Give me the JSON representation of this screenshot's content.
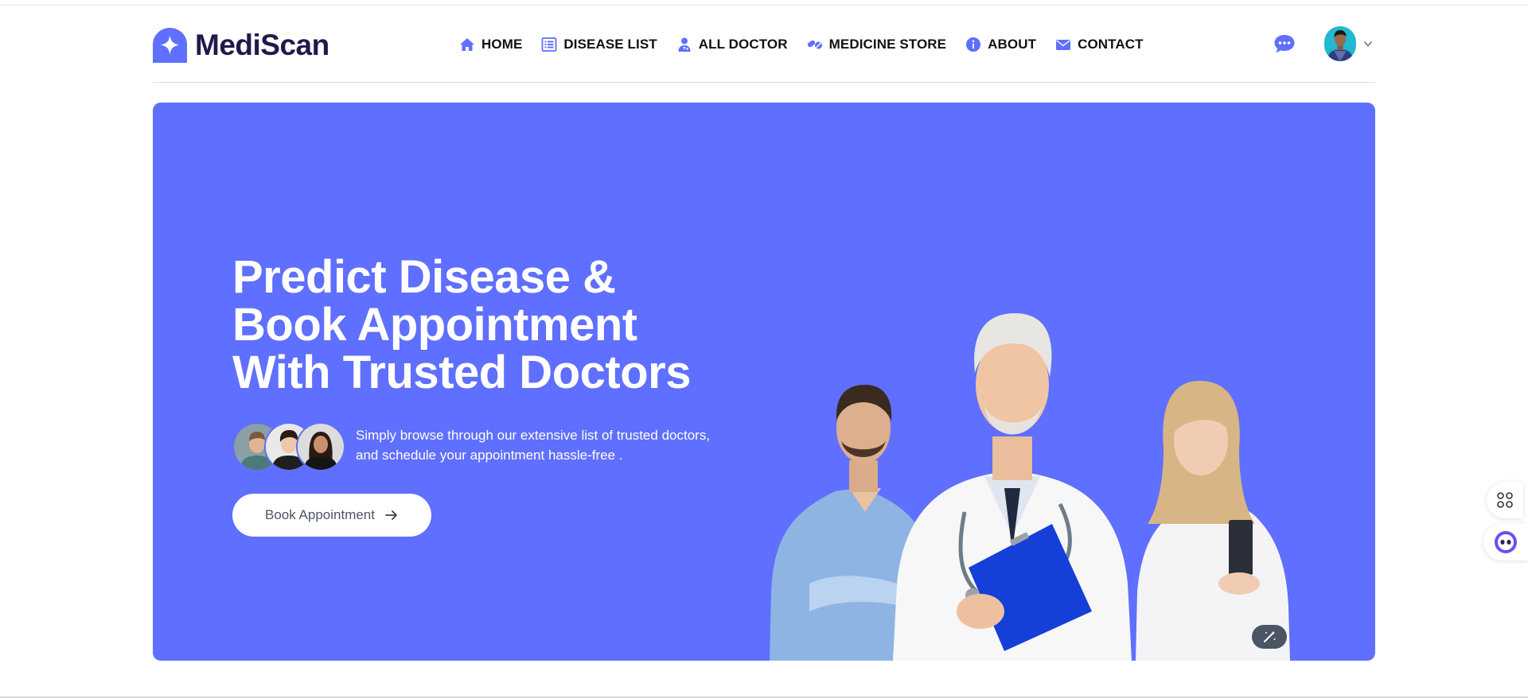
{
  "brand": {
    "name": "MediScan",
    "accent": "#5f6fff",
    "dark": "#1e1b4b"
  },
  "nav": {
    "items": [
      {
        "label": "HOME",
        "icon": "home-icon"
      },
      {
        "label": "DISEASE LIST",
        "icon": "list-icon"
      },
      {
        "label": "ALL DOCTOR",
        "icon": "doctor-icon"
      },
      {
        "label": "MEDICINE STORE",
        "icon": "pills-icon"
      },
      {
        "label": "ABOUT",
        "icon": "info-icon"
      },
      {
        "label": "CONTACT",
        "icon": "envelope-icon"
      }
    ]
  },
  "header_actions": {
    "chat_icon": "chat-bubble-icon",
    "profile_chevron_icon": "chevron-down-icon"
  },
  "hero": {
    "title_line1": "Predict Disease &",
    "title_line2": "Book Appointment",
    "title_line3": "With Trusted Doctors",
    "subtitle_line1": "Simply browse through our extensive list of trusted doctors,",
    "subtitle_line2": "and schedule your appointment hassle-free .",
    "cta_label": "Book Appointment",
    "cta_icon": "arrow-right-icon",
    "background": "#5f6fff"
  },
  "floating": {
    "grid_icon": "grid-icon",
    "assistant_icon": "assistant-bot-icon",
    "magic_icon": "magic-wand-icon"
  }
}
